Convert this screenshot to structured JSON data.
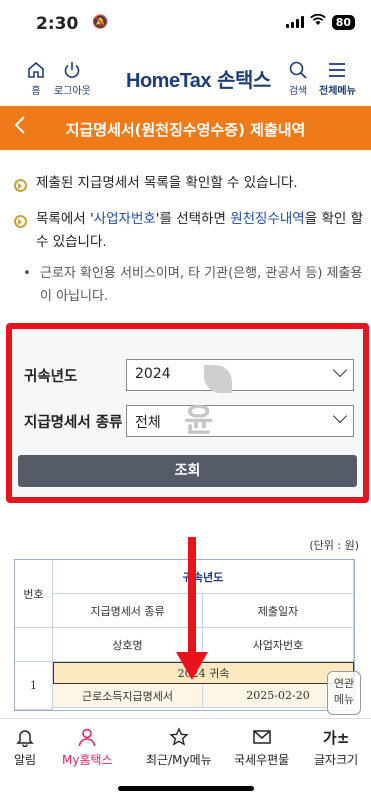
{
  "status": {
    "time": "2:30",
    "battery": "80"
  },
  "header": {
    "home": "홈",
    "logout": "로그아웃",
    "logo_en": "HomeTax",
    "logo_ko": "손택스",
    "search": "검색",
    "menu": "전체메뉴"
  },
  "titlebar": {
    "title": "지급명세서(원천징수영수증) 제출내역"
  },
  "info": {
    "line1": "제출된 지급명세서 목록을 확인할 수 있습니다.",
    "line2_pre": "목록에서 '",
    "line2_link1": "사업자번호",
    "line2_mid": "'를 선택하면 ",
    "line2_link2": "원천징수내역",
    "line2_post": "을 확인 할 수 있습니다.",
    "note": "근로자 확인용 서비스이며, 타 기관(은행, 관공서 등) 제출용이 아닙니다."
  },
  "search": {
    "year_label": "귀속년도",
    "year_value": "2024",
    "type_label": "지급명세서 종류",
    "type_value": "전체",
    "button": "조회",
    "watermark": "윤"
  },
  "unit": "(단위 : 원)",
  "table": {
    "header_year": "귀속년도",
    "col_no": "번호",
    "col_type": "지급명세서 종류",
    "col_date": "제출일자",
    "col_company": "상호명",
    "col_bizno": "사업자번호",
    "year_group": "2024 귀속",
    "rows": [
      {
        "no": "1",
        "type": "근로소득지급명세서",
        "date": "2025-02-20"
      }
    ]
  },
  "float_menu": {
    "line1": "연관",
    "line2": "메뉴"
  },
  "bottomnav": {
    "alarm": "알림",
    "myhometax": "My홈택스",
    "recent": "최근/My메뉴",
    "mail": "국세우편물",
    "fontsize": "글자크기",
    "fontsize_icon": "가±"
  },
  "colors": {
    "accent": "#ee7a1a",
    "brand": "#1d3d7a",
    "highlight": "#e8141c",
    "active": "#e0246e"
  }
}
